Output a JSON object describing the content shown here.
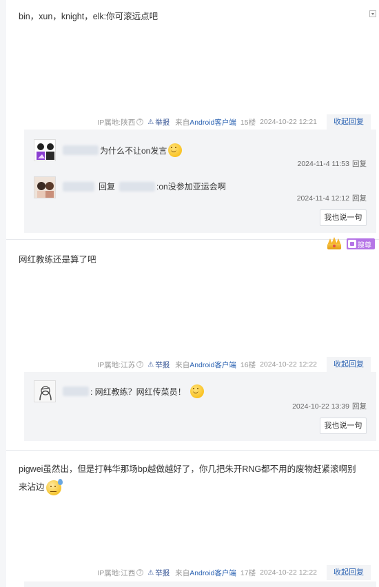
{
  "posts": [
    {
      "content": "bin，xun，knight，elk:你可滚远点吧",
      "meta": {
        "ip": "IP属地:陕西",
        "report": "举报",
        "client_prefix": "来自",
        "client": "Android客户端",
        "floor": "15楼",
        "date": "2024-10-22 12:21",
        "collapse": "收起回复"
      },
      "replies": [
        {
          "text": "为什么不让on发言",
          "time": "2024-11-4 11:53",
          "reply_btn": "回复"
        },
        {
          "reply_word": "回复",
          "text": ":on没参加亚运会啊",
          "time": "2024-11-4 12:12",
          "reply_btn": "回复"
        }
      ],
      "say": "我也说一句"
    },
    {
      "content": "网红教练还是算了吧",
      "meta": {
        "ip": "IP属地:江苏",
        "report": "举报",
        "client_prefix": "来自",
        "client": "Android客户端",
        "floor": "16楼",
        "date": "2024-10-22 12:22",
        "collapse": "收起回复"
      },
      "replies": [
        {
          "text": ": 网红教练？网红传菜员！",
          "time": "2024-10-22 13:39",
          "reply_btn": "回复"
        }
      ],
      "say": "我也说一句"
    },
    {
      "content": "pigwei虽然出，但是打韩华那场bp越做越好了，你几把朱开RNG都不用的废物赶紧滚啊别来沾边",
      "meta": {
        "ip": "IP属地:江西",
        "report": "举报",
        "client_prefix": "来自",
        "client": "Android客户端",
        "floor": "17楼",
        "date": "2024-10-22 12:22",
        "collapse": "收起回复"
      }
    }
  ],
  "badge": {
    "label": "搜尊"
  },
  "icons": {
    "help": "question-circle-icon",
    "report": "warning-triangle-icon",
    "dropdown": "dropdown-arrow-icon",
    "crown": "crown-icon",
    "emoji": "smile-emoji-icon"
  },
  "colors": {
    "link": "#2d64b3",
    "box_bg": "#f3f4f6",
    "badge": "#b574e6"
  }
}
